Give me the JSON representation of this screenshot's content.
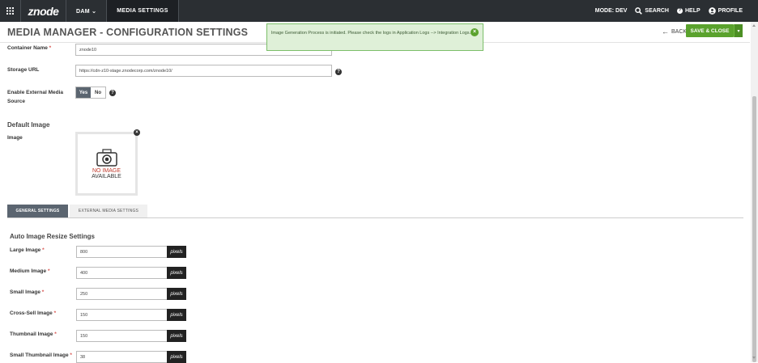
{
  "topbar": {
    "logo": "znode",
    "nav": [
      {
        "label": "DAM ⌄"
      },
      {
        "label": "MEDIA SETTINGS"
      }
    ],
    "mode": "MODE: DEV",
    "search": "SEARCH",
    "help": "HELP",
    "profile": "PROFILE"
  },
  "header": {
    "title": "MEDIA MANAGER - CONFIGURATION SETTINGS",
    "back": "BACK",
    "save_close": "SAVE & CLOSE"
  },
  "notification": {
    "message": "Image Generation Process is initiated. Please check the logs in Application Logs --> Integration Logs."
  },
  "form": {
    "container_name": {
      "label": "Container Name",
      "required": "*",
      "value": "znode10"
    },
    "storage_url": {
      "label": "Storage URL",
      "value": "https://cdn-z10-stage.znodecorp.com/znode10/"
    },
    "enable_external": {
      "label_line1": "Enable External Media",
      "label_line2": "Source",
      "yes": "Yes",
      "no": "No"
    }
  },
  "default_image": {
    "title": "Default Image",
    "image_label": "Image",
    "no_image_line1": "NO IMAGE",
    "no_image_line2": "AVAILABLE"
  },
  "tabs": [
    {
      "label": "GENERAL SETTINGS"
    },
    {
      "label": "EXTERNAL MEDIA SETTINGS"
    }
  ],
  "resize": {
    "title": "Auto Image Resize Settings",
    "suffix": "pixels",
    "rows": [
      {
        "label": "Large Image",
        "required": "*",
        "value": "800"
      },
      {
        "label": "Medium Image",
        "required": "*",
        "value": "400"
      },
      {
        "label": "Small Image",
        "required": "*",
        "value": "250"
      },
      {
        "label": "Cross-Sell Image",
        "required": "*",
        "value": "150"
      },
      {
        "label": "Thumbnail Image",
        "required": "*",
        "value": "150"
      },
      {
        "label": "Small Thumbnail Image",
        "required": "*",
        "value": "38"
      }
    ]
  },
  "colors": {
    "topbar": "#2b2f33",
    "save_green": "#5aa22d",
    "notify_bg": "#dff0d8",
    "tab_active": "#5b6570",
    "required": "#d9534f"
  }
}
